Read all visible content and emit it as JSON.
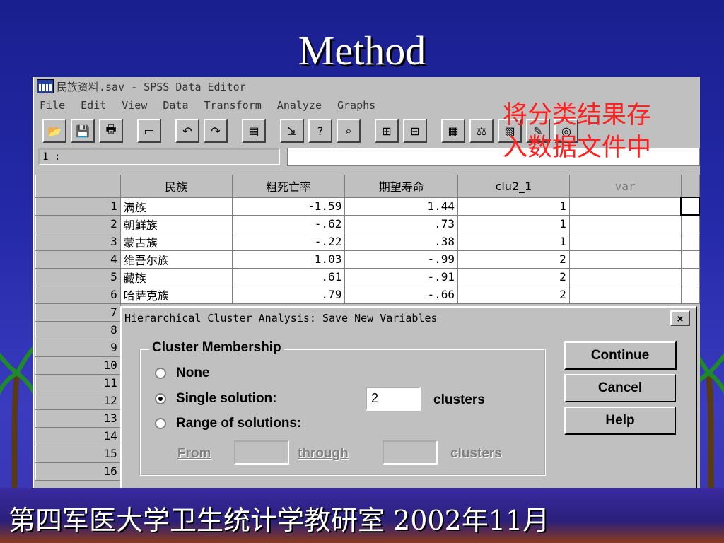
{
  "slide": {
    "title": "Method",
    "footer": "第四军医大学卫生统计学教研室  2002年11月",
    "annotation_line1": "将分类结果存",
    "annotation_line2": "入数据文件中"
  },
  "window": {
    "title": "民族资料.sav - SPSS Data Editor",
    "menus": [
      "File",
      "Edit",
      "View",
      "Data",
      "Transform",
      "Analyze",
      "Graphs"
    ],
    "cell_ref": "1 :"
  },
  "toolbar": [
    {
      "icon": "open-folder-icon",
      "glyph": "📂"
    },
    {
      "icon": "save-icon",
      "glyph": "💾"
    },
    {
      "icon": "print-icon",
      "glyph": "🖶"
    },
    {
      "icon": "dialog-recall-icon",
      "glyph": "▭"
    },
    {
      "icon": "undo-icon",
      "glyph": "↶"
    },
    {
      "icon": "redo-icon",
      "glyph": "↷"
    },
    {
      "icon": "goto-chart-icon",
      "glyph": "▤"
    },
    {
      "icon": "goto-case-icon",
      "glyph": "⇲"
    },
    {
      "icon": "variables-icon",
      "glyph": "?"
    },
    {
      "icon": "find-icon",
      "glyph": "⌕"
    },
    {
      "icon": "insert-case-icon",
      "glyph": "⊞"
    },
    {
      "icon": "insert-variable-icon",
      "glyph": "⊟"
    },
    {
      "icon": "split-file-icon",
      "glyph": "▦"
    },
    {
      "icon": "weight-cases-icon",
      "glyph": "⚖"
    },
    {
      "icon": "select-cases-icon",
      "glyph": "▧"
    },
    {
      "icon": "value-labels-icon",
      "glyph": "✎"
    },
    {
      "icon": "use-sets-icon",
      "glyph": "◎"
    }
  ],
  "grid": {
    "headers": [
      "民族",
      "粗死亡率",
      "期望寿命",
      "clu2_1",
      "var"
    ],
    "rows": [
      {
        "n": "1",
        "name": "满族",
        "a": "-1.59",
        "b": "1.44",
        "c": "1"
      },
      {
        "n": "2",
        "name": "朝鲜族",
        "a": "-.62",
        "b": ".73",
        "c": "1"
      },
      {
        "n": "3",
        "name": "蒙古族",
        "a": "-.22",
        "b": ".38",
        "c": "1"
      },
      {
        "n": "4",
        "name": "维吾尔族",
        "a": "1.03",
        "b": "-.99",
        "c": "2"
      },
      {
        "n": "5",
        "name": "藏族",
        "a": ".61",
        "b": "-.91",
        "c": "2"
      },
      {
        "n": "6",
        "name": "哈萨克族",
        "a": ".79",
        "b": "-.66",
        "c": "2"
      }
    ],
    "empty_rows": [
      "7",
      "8",
      "9",
      "10",
      "11",
      "12",
      "13",
      "14",
      "15",
      "16"
    ]
  },
  "dialog": {
    "title": "Hierarchical Cluster Analysis: Save New Variables",
    "close": "×",
    "group_label": "Cluster Membership",
    "none_label": "None",
    "single_label": "Single solution:",
    "single_value": "2",
    "single_unit": "clusters",
    "range_label": "Range of solutions:",
    "from_label": "From",
    "through_label": "through",
    "range_unit": "clusters",
    "selected": "single",
    "buttons": {
      "continue": "Continue",
      "cancel": "Cancel",
      "help": "Help"
    }
  }
}
